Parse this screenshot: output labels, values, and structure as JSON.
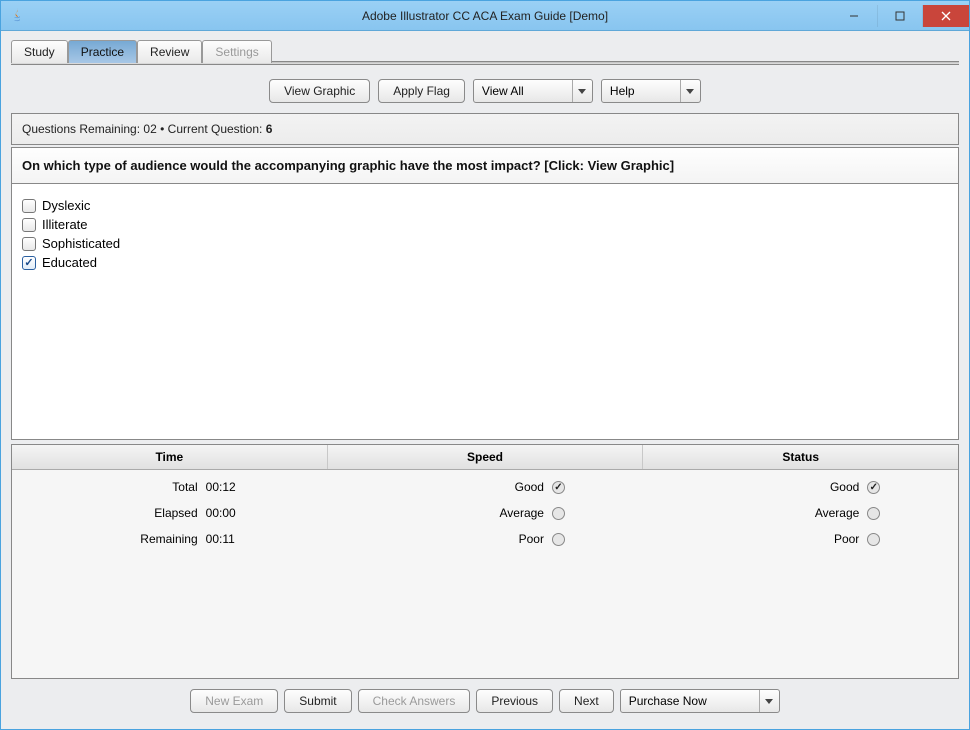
{
  "window": {
    "title": "Adobe Illustrator CC ACA Exam Guide [Demo]"
  },
  "tabs": {
    "study": "Study",
    "practice": "Practice",
    "review": "Review",
    "settings": "Settings",
    "active": "practice"
  },
  "toolbar": {
    "view_graphic": "View Graphic",
    "apply_flag": "Apply Flag",
    "view_all": "View All",
    "help": "Help"
  },
  "status": {
    "questions_remaining_label": "Questions Remaining:",
    "questions_remaining": "02",
    "separator": "•",
    "current_question_label": "Current Question:",
    "current_question": "6"
  },
  "question": {
    "text": "On which type of audience would the accompanying graphic have the most impact? [Click: View Graphic]"
  },
  "answers": [
    {
      "label": "Dyslexic",
      "checked": false
    },
    {
      "label": "Illiterate",
      "checked": false
    },
    {
      "label": "Sophisticated",
      "checked": false
    },
    {
      "label": "Educated",
      "checked": true
    }
  ],
  "stats": {
    "headers": {
      "time": "Time",
      "speed": "Speed",
      "status": "Status"
    },
    "time": {
      "total_label": "Total",
      "total_value": "00:12",
      "elapsed_label": "Elapsed",
      "elapsed_value": "00:00",
      "remaining_label": "Remaining",
      "remaining_value": "00:11"
    },
    "speed": {
      "good": "Good",
      "average": "Average",
      "poor": "Poor",
      "selected": "good"
    },
    "status_col": {
      "good": "Good",
      "average": "Average",
      "poor": "Poor",
      "selected": "good"
    }
  },
  "bottom": {
    "new_exam": "New Exam",
    "submit": "Submit",
    "check_answers": "Check Answers",
    "previous": "Previous",
    "next": "Next",
    "purchase_now": "Purchase Now"
  }
}
